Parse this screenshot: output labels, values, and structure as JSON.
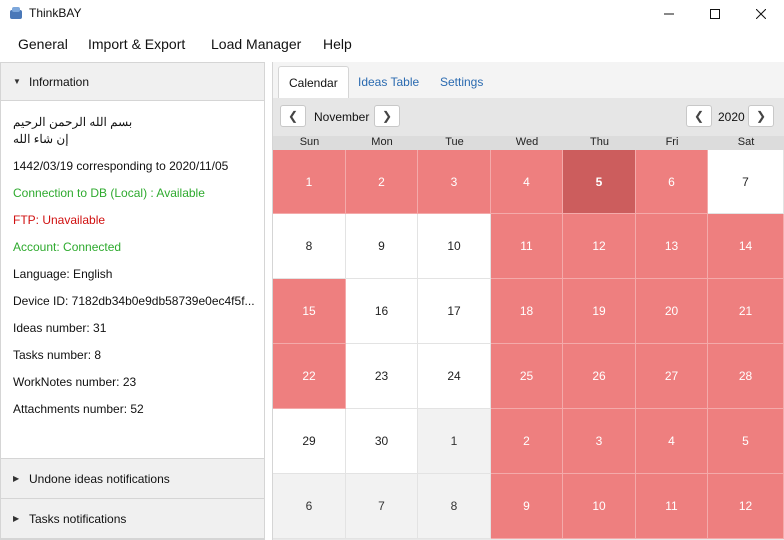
{
  "window": {
    "title": "ThinkBAY"
  },
  "menu": [
    "General",
    "Import & Export",
    "Load Manager",
    "Help"
  ],
  "left_panel": {
    "information_header": "Information",
    "arabic_line1": "بسم الله الرحمن الرحيم",
    "arabic_line2": "إن شاء الله",
    "date_line": "1442/03/19 corresponding to 2020/11/05",
    "db_status": "Connection to DB (Local) : Available",
    "ftp_status": "FTP: Unavailable",
    "account_status": "Account: Connected",
    "language": "Language: English",
    "device_id": "Device ID: 7182db34b0e9db58739e0ec4f5f...",
    "ideas_number": "Ideas number: 31",
    "tasks_number": "Tasks number: 8",
    "worknotes_number": "WorkNotes number: 23",
    "attachments_number": "Attachments number: 52",
    "undone_header": "Undone ideas notifications",
    "tasks_header": "Tasks notifications"
  },
  "tabs": [
    "Calendar",
    "Ideas Table",
    "Settings"
  ],
  "calendar": {
    "month": "November",
    "year": "2020",
    "weekdays": [
      "Sun",
      "Mon",
      "Tue",
      "Wed",
      "Thu",
      "Fri",
      "Sat"
    ],
    "cells": [
      {
        "d": "1",
        "s": "red"
      },
      {
        "d": "2",
        "s": "red"
      },
      {
        "d": "3",
        "s": "red"
      },
      {
        "d": "4",
        "s": "red"
      },
      {
        "d": "5",
        "s": "today"
      },
      {
        "d": "6",
        "s": "red"
      },
      {
        "d": "7",
        "s": "white"
      },
      {
        "d": "8",
        "s": "white"
      },
      {
        "d": "9",
        "s": "white"
      },
      {
        "d": "10",
        "s": "white"
      },
      {
        "d": "11",
        "s": "red"
      },
      {
        "d": "12",
        "s": "red"
      },
      {
        "d": "13",
        "s": "red"
      },
      {
        "d": "14",
        "s": "red"
      },
      {
        "d": "15",
        "s": "red"
      },
      {
        "d": "16",
        "s": "white"
      },
      {
        "d": "17",
        "s": "white"
      },
      {
        "d": "18",
        "s": "red"
      },
      {
        "d": "19",
        "s": "red"
      },
      {
        "d": "20",
        "s": "red"
      },
      {
        "d": "21",
        "s": "red"
      },
      {
        "d": "22",
        "s": "red"
      },
      {
        "d": "23",
        "s": "white"
      },
      {
        "d": "24",
        "s": "white"
      },
      {
        "d": "25",
        "s": "red"
      },
      {
        "d": "26",
        "s": "red"
      },
      {
        "d": "27",
        "s": "red"
      },
      {
        "d": "28",
        "s": "red"
      },
      {
        "d": "29",
        "s": "white"
      },
      {
        "d": "30",
        "s": "white"
      },
      {
        "d": "1",
        "s": "other"
      },
      {
        "d": "2",
        "s": "other-red"
      },
      {
        "d": "3",
        "s": "other-red"
      },
      {
        "d": "4",
        "s": "other-red"
      },
      {
        "d": "5",
        "s": "other-red"
      },
      {
        "d": "6",
        "s": "other"
      },
      {
        "d": "7",
        "s": "other"
      },
      {
        "d": "8",
        "s": "other"
      },
      {
        "d": "9",
        "s": "other-red"
      },
      {
        "d": "10",
        "s": "other-red"
      },
      {
        "d": "11",
        "s": "other-red"
      },
      {
        "d": "12",
        "s": "other-red"
      }
    ]
  },
  "colors": {
    "accent": "#2a6ab0",
    "event_red": "#ee7f7f",
    "today_red": "#cc5d5d",
    "ok_green": "#2eaa2e",
    "error_red": "#d01010"
  }
}
